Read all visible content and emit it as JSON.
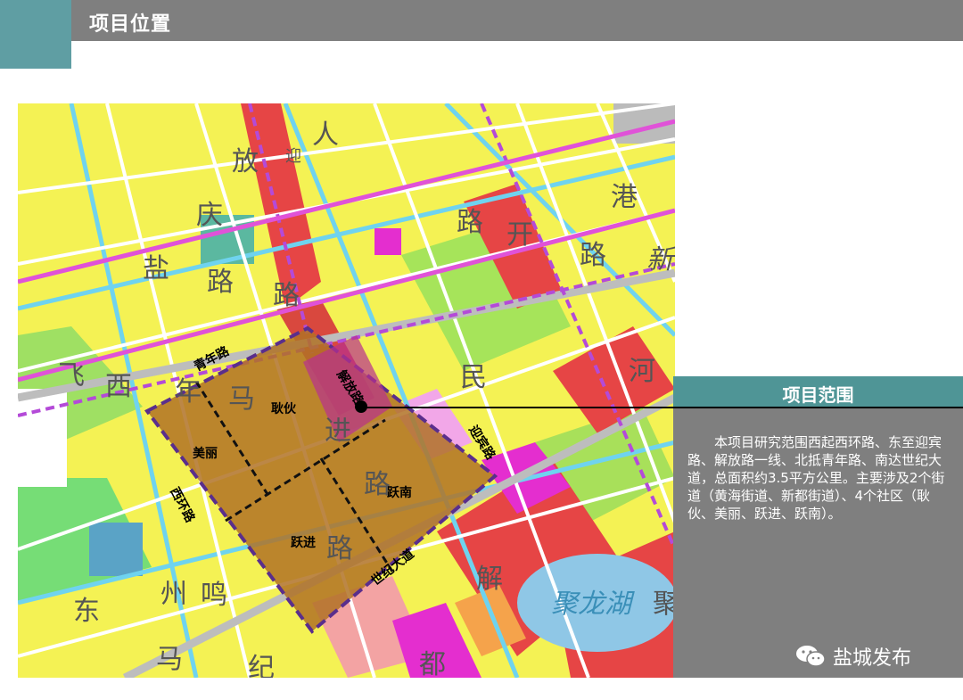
{
  "header": {
    "title": "项目位置"
  },
  "map": {
    "areas": [
      "耿伙",
      "美丽",
      "跃南",
      "跃进"
    ],
    "roads": [
      "青年路",
      "解放路",
      "迎宾路",
      "西环路",
      "世纪大道"
    ],
    "background_chars": [
      "人",
      "放",
      "迎",
      "庆",
      "盐",
      "路",
      "路",
      "港",
      "路",
      "开",
      "路",
      "新",
      "民",
      "河",
      "飞",
      "西",
      "年",
      "马",
      "进",
      "路",
      "路",
      "东",
      "州",
      "鸣",
      "解",
      "马",
      "纪",
      "都",
      "聚龙湖",
      "聚"
    ]
  },
  "info_panel": {
    "title": "项目范围",
    "body": "本项目研究范围西起西环路、东至迎宾路、解放路一线、北抵青年路、南达世纪大道，总面积约3.5平方公里。主要涉及2个街道（黄海街道、新都街道）、4个社区（耿伙、美丽、跃进、跃南）。"
  },
  "watermark": {
    "label": "盐城发布",
    "icon": "wechat-icon"
  },
  "colors": {
    "header_bar": "#7f7f7f",
    "accent_teal": "#5f9ea3",
    "panel_title": "#4f9596",
    "project_area": "#c8862a",
    "boundary": "#5a2e8c"
  }
}
